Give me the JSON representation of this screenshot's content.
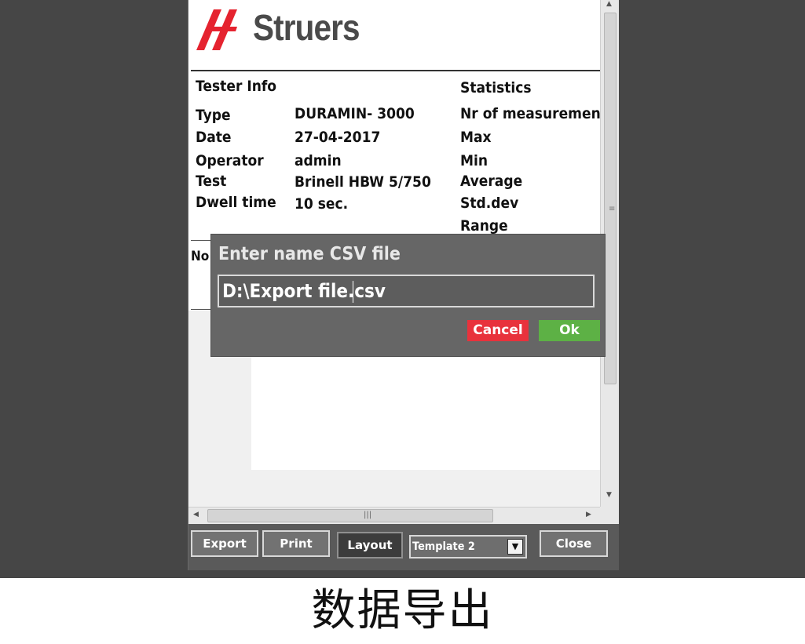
{
  "brand": {
    "logo_text": "Struers",
    "logo_color": "#e5232f",
    "text_color": "#4a4a4a"
  },
  "report": {
    "tester_info": {
      "heading": "Tester Info",
      "rows": [
        {
          "label": "Type",
          "value": "DURAMIN- 3000"
        },
        {
          "label": "Date",
          "value": "27-04-2017"
        },
        {
          "label": "Operator",
          "value": "admin"
        },
        {
          "label": "Test",
          "value": "Brinell HBW 5/750"
        },
        {
          "label": "Dwell time",
          "value": "10 sec."
        }
      ]
    },
    "statistics": {
      "heading": "Statistics",
      "rows": [
        "Nr of measuremen",
        "Max",
        "Min",
        "Average",
        "Std.dev",
        "Range"
      ]
    },
    "notes_label": "No"
  },
  "dialog": {
    "title": "Enter name CSV file",
    "filename": "D:\\Export file.csv",
    "cancel_label": "Cancel",
    "ok_label": "Ok",
    "cancel_color": "#e8323c",
    "ok_color": "#5db145"
  },
  "toolbar": {
    "export_label": "Export",
    "print_label": "Print",
    "layout_label": "Layout",
    "template_value": "Template 2",
    "close_label": "Close"
  },
  "caption": "数据导出"
}
